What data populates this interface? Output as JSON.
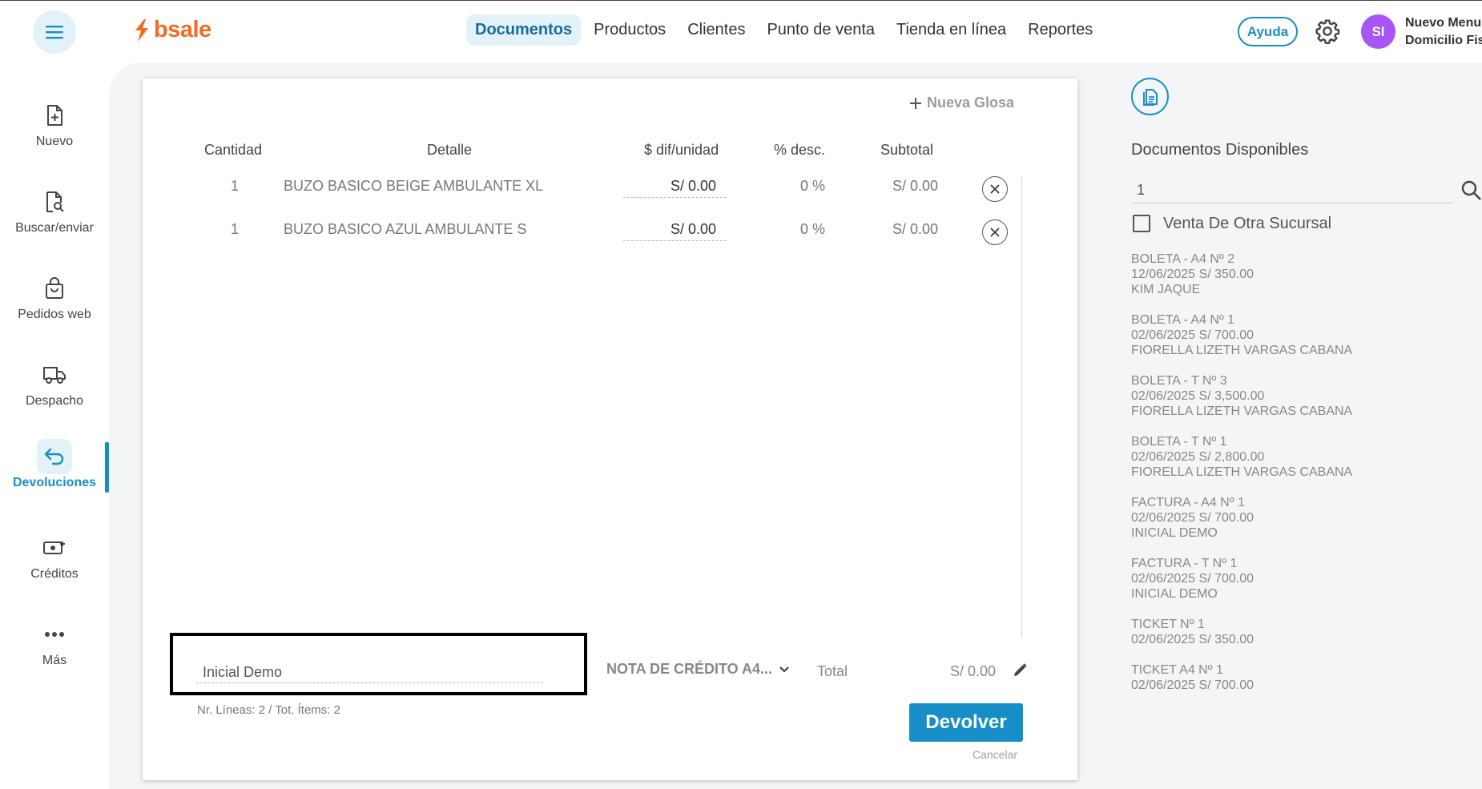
{
  "header": {
    "logo_text": "bsale",
    "nav": [
      "Documentos",
      "Productos",
      "Clientes",
      "Punto de venta",
      "Tienda en línea",
      "Reportes"
    ],
    "active_nav": "Documentos",
    "help_label": "Ayuda",
    "avatar_initials": "SI",
    "user_line1": "Nuevo Menu",
    "user_line2": "Domicilio Fiscal"
  },
  "sidebar": {
    "items": [
      {
        "label": "Nuevo",
        "icon": "file-plus-icon"
      },
      {
        "label": "Buscar/enviar",
        "icon": "file-search-icon"
      },
      {
        "label": "Pedidos web",
        "icon": "shopping-bag-icon"
      },
      {
        "label": "Despacho",
        "icon": "truck-icon"
      },
      {
        "label": "Devoluciones",
        "icon": "return-arrow-icon"
      },
      {
        "label": "Créditos",
        "icon": "cash-plus-icon"
      },
      {
        "label": "Más",
        "icon": "more-dots-icon"
      }
    ],
    "active": "Devoluciones"
  },
  "document": {
    "new_gloss_label": "Nueva Glosa",
    "columns": [
      "Cantidad",
      "Detalle",
      "$ dif/unidad",
      "% desc.",
      "Subtotal"
    ],
    "rows": [
      {
        "qty": "1",
        "detail": "BUZO BASICO BEIGE AMBULANTE XL",
        "dif": "S/ 0.00",
        "disc": "0 %",
        "subtotal": "S/ 0.00"
      },
      {
        "qty": "1",
        "detail": "BUZO BASICO AZUL AMBULANTE S",
        "dif": "S/ 0.00",
        "disc": "0 %",
        "subtotal": "S/ 0.00"
      }
    ],
    "client_value": "Inicial Demo",
    "doc_type": "NOTA DE CRÉDITO A4...",
    "total_label": "Total",
    "total_value": "S/ 0.00",
    "lines_info": "Nr. Líneas: 2 / Tot. Ítems: 2",
    "submit_label": "Devolver",
    "cancel_label": "Cancelar"
  },
  "right_panel": {
    "title": "Documentos Disponibles",
    "search_value": "1",
    "checkbox_label": "Venta De Otra Sucursal",
    "documents": [
      {
        "line1": "BOLETA - A4 Nº 2",
        "line2": "12/06/2025 S/ 350.00",
        "line3": "KIM JAQUE"
      },
      {
        "line1": "BOLETA - A4 Nº 1",
        "line2": "02/06/2025 S/ 700.00",
        "line3": "FIORELLA LIZETH VARGAS CABANA"
      },
      {
        "line1": "BOLETA - T Nº 3",
        "line2": "02/06/2025 S/ 3,500.00",
        "line3": "FIORELLA LIZETH VARGAS CABANA"
      },
      {
        "line1": "BOLETA - T Nº 1",
        "line2": "02/06/2025 S/ 2,800.00",
        "line3": "FIORELLA LIZETH VARGAS CABANA"
      },
      {
        "line1": "FACTURA - A4 Nº 1",
        "line2": "02/06/2025 S/ 700.00",
        "line3": "INICIAL DEMO"
      },
      {
        "line1": "FACTURA - T Nº 1",
        "line2": "02/06/2025 S/ 700.00",
        "line3": "INICIAL DEMO"
      },
      {
        "line1": "TICKET Nº 1",
        "line2": "02/06/2025 S/ 350.00",
        "line3": ""
      },
      {
        "line1": "TICKET A4 Nº 1",
        "line2": "02/06/2025 S/ 700.00",
        "line3": ""
      }
    ]
  },
  "colors": {
    "accent": "#168fc8",
    "brand": "#f26b21",
    "avatar": "#a855f7",
    "active_bg": "#e3f1f9"
  }
}
